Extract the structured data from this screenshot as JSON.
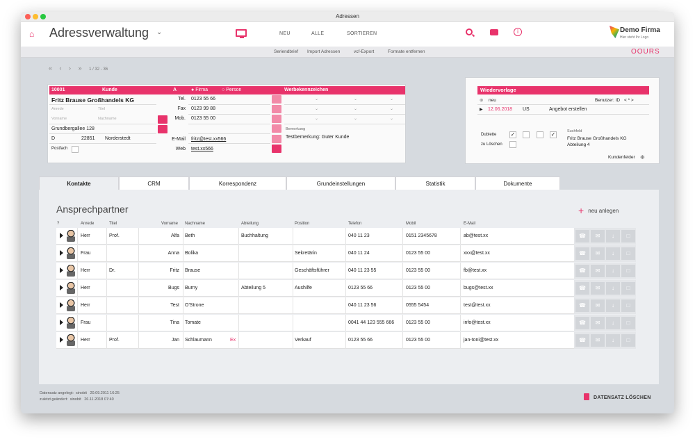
{
  "window": {
    "title": "Adressen"
  },
  "topbar": {
    "app_title": "Adressverwaltung",
    "nav": [
      "NEU",
      "ALLE",
      "SORTIEREN"
    ],
    "logo_name": "Demo Firma",
    "logo_sub": "Hier steht Ihr Logo"
  },
  "subbar": {
    "items": [
      "Seriendbrief",
      "Import Adressen",
      "vcf-Export",
      "Formate entfernen"
    ],
    "brand": "OOURS"
  },
  "recnav": {
    "count": "1 / 32 - 36"
  },
  "address": {
    "id": "10001",
    "category": "Kunde",
    "abc": "A",
    "type_firma": "Firma",
    "type_person": "Person",
    "werbe_label": "Werbekennzeichen",
    "company": "Fritz Brause Großhandels KG",
    "anrede_ph": "Anrede",
    "titel_ph": "Titel",
    "vorname_ph": "Vorname",
    "nachname_ph": "Nachname",
    "street": "Grundbergallee 128",
    "country": "D",
    "zip": "22851",
    "city": "Norderstedt",
    "postfach": "Postfach",
    "tel_label": "Tel.",
    "tel": "0123 55 66",
    "fax_label": "Fax",
    "fax": "0123 99 88",
    "mob_label": "Mob.",
    "mob": "0123 55 00",
    "email_label": "E-Mail",
    "email": "fritz@test.xx566",
    "web_label": "Web",
    "web": "test.xx566",
    "bemerkung_label": "Bemerkung",
    "bemerkung": "Testbemerkung: Guter Kunde"
  },
  "wiedervorlage": {
    "title": "Wiedervorlage",
    "new_label": "neu",
    "user_label": "Benutzer: ID",
    "user_value": "< * >",
    "date": "12.06.2018",
    "user": "US",
    "task": "Angebot erstellen",
    "dublette": "Dublette",
    "zu_loeschen": "zu Löschen",
    "suchfeld_label": "Suchfeld",
    "suchfeld_1": "Fritz Brause Großhandels KG",
    "suchfeld_2": "Abteilung 4",
    "kundenfelder": "Kundenfelder"
  },
  "tabs": [
    "Kontakte",
    "CRM",
    "Korrespondenz",
    "Grundeinstellungen",
    "Statistik",
    "Dokumente"
  ],
  "contacts": {
    "title": "Ansprechpartner",
    "add_label": "neu anlegen",
    "headers": [
      "?",
      "Anrede",
      "Titel",
      "Vorname",
      "Nachname",
      "Abteilung",
      "Position",
      "Telefon",
      "Mobil",
      "E-Mail"
    ],
    "rows": [
      {
        "anrede": "Herr",
        "titel": "Prof.",
        "vorname": "Alfa",
        "nachname": "Beth",
        "abteilung": "Buchhaltung",
        "position": "",
        "telefon": "040 11 23",
        "mobil": "0151 2345678",
        "email": "ab@test.xx"
      },
      {
        "anrede": "Frau",
        "titel": "",
        "vorname": "Anna",
        "nachname": "Bolika",
        "abteilung": "",
        "position": "Sekretärin",
        "telefon": "040 11 24",
        "mobil": "0123 55 00",
        "email": "xxx@test.xx"
      },
      {
        "anrede": "Herr",
        "titel": "Dr.",
        "vorname": "Fritz",
        "nachname": "Brause",
        "abteilung": "",
        "position": "Geschäftsführer",
        "telefon": "040 11 23 55",
        "mobil": "0123 55 00",
        "email": "fb@test.xx"
      },
      {
        "anrede": "Herr",
        "titel": "",
        "vorname": "Bugs",
        "nachname": "Burny",
        "abteilung": "Abteilung 5",
        "position": "Aushilfe",
        "telefon": "0123 55 66",
        "mobil": "0123 55 00",
        "email": "bugs@test.xx"
      },
      {
        "anrede": "Herr",
        "titel": "",
        "vorname": "Test",
        "nachname": "O'Strone",
        "abteilung": "",
        "position": "",
        "telefon": "040 11 23 56",
        "mobil": "0555 5454",
        "email": "test@test.xx"
      },
      {
        "anrede": "Frau",
        "titel": "",
        "vorname": "Tina",
        "nachname": "Tomate",
        "abteilung": "",
        "position": "",
        "telefon": "0041 44 123 555 666",
        "mobil": "0123 55 00",
        "email": "info@test.xx"
      },
      {
        "anrede": "Herr",
        "titel": "Prof.",
        "vorname": "Jan",
        "nachname": "Schlaumann",
        "extra": "Ex",
        "abteilung": "",
        "position": "Verkauf",
        "telefon": "0123 55 66",
        "mobil": "0123 55 00",
        "email": "jan-toni@test.xx"
      }
    ]
  },
  "footer": {
    "created_label": "Datensatz angelegt:",
    "created_user": "sinobit",
    "created_date": "20.09.2011 16:25",
    "changed_label": "zuletzt geändert:",
    "changed_user": "sinobit",
    "changed_date": "26.11.2018 07:40",
    "delete_label": "DATENSATZ LÖSCHEN"
  },
  "colors": {
    "accent": "#e8336b"
  }
}
